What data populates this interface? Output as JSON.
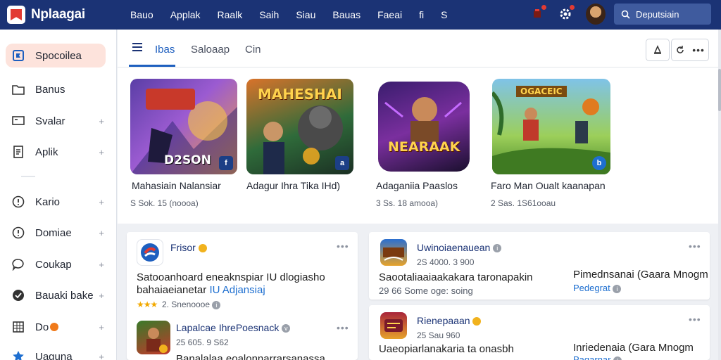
{
  "app": {
    "title": "Nplaagai"
  },
  "topnav": [
    "Bauo",
    "Applak",
    "Raalk",
    "Saih",
    "Siau",
    "Bauas",
    "Faeai",
    "fi",
    "S"
  ],
  "search": {
    "placeholder": "Deputsiain"
  },
  "sidebar": {
    "items": [
      {
        "label": "Spocoilea",
        "icon": "flag-icon",
        "active": true,
        "chevron": false
      },
      {
        "label": "Banus",
        "icon": "folder-icon",
        "chevron": false
      },
      {
        "label": "Svalar",
        "icon": "screen-icon",
        "chevron": true
      },
      {
        "label": "Aplik",
        "icon": "document-icon",
        "chevron": true
      },
      {
        "label": "Kario",
        "icon": "info-circle-icon",
        "chevron": true
      },
      {
        "label": "Domiae",
        "icon": "info-circle-icon",
        "chevron": true
      },
      {
        "label": "Coukap",
        "icon": "chat-icon",
        "chevron": true
      },
      {
        "label": "Bauaki bake",
        "icon": "check-circle-icon",
        "chevron": true
      },
      {
        "label": "Do",
        "icon": "grid-icon",
        "chevron": true
      },
      {
        "label": "Uaguna",
        "icon": "star-icon",
        "chevron": true
      }
    ]
  },
  "tabs": [
    {
      "label": "Ibas",
      "active": true
    },
    {
      "label": "Saloaap"
    },
    {
      "label": "Cin"
    }
  ],
  "featured": [
    {
      "title": "Mahasiain Nalansiar",
      "meta": "S  Sok. 15 (noooa)",
      "art": "D2SON",
      "badge": "f"
    },
    {
      "title": "Adagur Ihra Tika IHd)",
      "meta": "",
      "art": "MAHESHAI",
      "badge": "a"
    },
    {
      "title": "Adaganiia Paaslos",
      "meta": "3  Ss. 18 amooa)",
      "art": "NEARAAK",
      "badge": ""
    },
    {
      "title": "Faro Man Oualt kaanapan",
      "meta": "2  Sas. 1S61ooau",
      "art": "OGACEIC",
      "badge": "b"
    }
  ],
  "list_left": {
    "item1": {
      "name": "Frisor",
      "desc": "Satooanhoard eneaknspiar IU dlogiasho",
      "desc2_plain": "bahaiaeianetar",
      "desc2_link": "IU Adjansiaj",
      "rating": "★★★",
      "meta": "2.  Snenoooe"
    },
    "item2": {
      "name": "Lapalcae IhrePoesnack",
      "meta": "25 605. 9 S62",
      "desc": "Banalalaa eoalonnarrarsanassa"
    }
  },
  "list_right": {
    "item1": {
      "name": "Uwinoiaenauean",
      "meta": "2S 4000. 3 900",
      "desc": "Saootaliaaiaakakara taronapakin",
      "side": "Pimednsanai (Gaara Mnogm",
      "side_link": "Pedegrat",
      "meta2": "29 66 Some oge: soing"
    },
    "item2": {
      "name": "Rienepaaan",
      "meta": "25 Sau 960",
      "desc": "Uaeopiarlanakaria ta onasbh",
      "side": "Inriedenaia (Gara Mnogm",
      "side_link": "Paqarnar"
    }
  },
  "colors": {
    "topbar": "#1b3375",
    "accent": "#1e5fbf",
    "active_bg": "#fde3dc"
  }
}
